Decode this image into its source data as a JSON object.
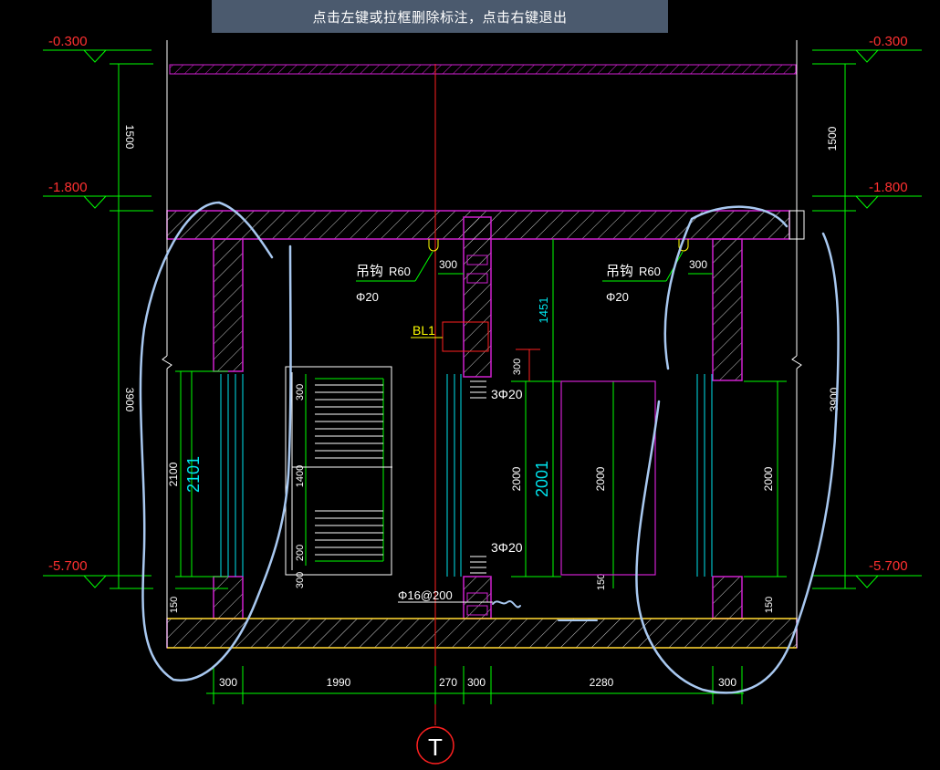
{
  "hint": "点击左键或拉框删除标注，点击右键退出",
  "colors": {
    "concrete": "#d020d0",
    "dim": "#00ff00",
    "axis": "#ff2020",
    "text": "#ffffff",
    "cyan": "#00e5ee",
    "yellow": "#ffff00",
    "markup": "#a8c8f0"
  },
  "elevations": {
    "top_left": "-0.300",
    "top_right": "-0.300",
    "mid_left": "-1.800",
    "mid_right": "-1.800",
    "bot_left": "-5.700",
    "bot_right": "-5.700"
  },
  "vertical_dims": {
    "left_1500": "1500",
    "right_1500": "1500",
    "left_3900": "3900",
    "right_3900": "3900",
    "left_2100": "2100",
    "left_2101": "2101",
    "left_150": "150",
    "right_150": "150",
    "mid_1451": "1451",
    "mid_300": "300",
    "mid_2000": "2000",
    "mid_2001": "2001",
    "mid_150": "150",
    "opening_2000": "2000",
    "right_2000": "2000",
    "stair_300_top": "300",
    "stair_1400": "1400",
    "stair_200": "200",
    "stair_300_bot": "300"
  },
  "labels": {
    "hook_left": "吊钩",
    "hook_left_r": "R60",
    "hook_left_dia": "Φ20",
    "hook_left_300": "300",
    "hook_right": "吊钩",
    "hook_right_r": "R60",
    "hook_right_dia": "Φ20",
    "hook_right_300": "300",
    "beam": "BL1",
    "rebar_top": "3Φ20",
    "rebar_bot": "3Φ20",
    "rebar_stir": "Φ16@200"
  },
  "horizontal_dims": [
    "300",
    "1990",
    "270",
    "300",
    "2280",
    "300"
  ],
  "axis_label": "T"
}
